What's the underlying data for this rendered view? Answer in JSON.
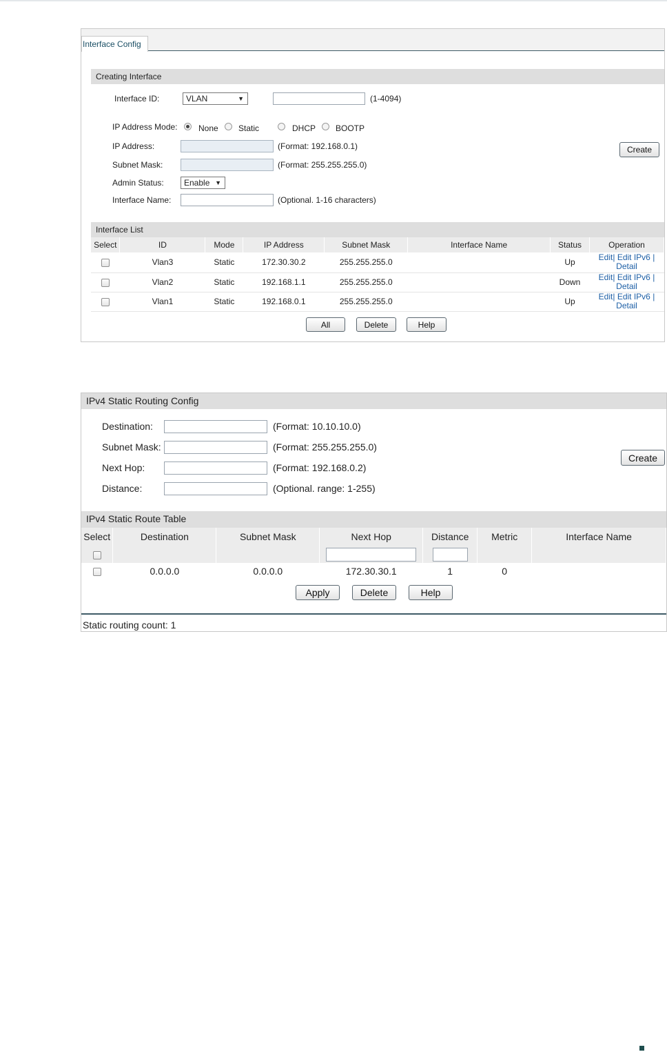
{
  "interface_config": {
    "tab_label": "Interface Config",
    "creating_section_title": "Creating Interface",
    "interface_id_label": "Interface ID:",
    "interface_id_select_value": "VLAN",
    "interface_id_hint": "(1-4094)",
    "ip_mode_label": "IP Address Mode:",
    "ip_modes": [
      "None",
      "Static",
      "DHCP",
      "BOOTP"
    ],
    "ip_mode_selected": "None",
    "ip_address_label": "IP Address:",
    "ip_address_hint": "(Format: 192.168.0.1)",
    "subnet_mask_label": "Subnet Mask:",
    "subnet_mask_hint": "(Format: 255.255.255.0)",
    "admin_status_label": "Admin Status:",
    "admin_status_value": "Enable",
    "interface_name_label": "Interface Name:",
    "interface_name_hint": "(Optional. 1-16 characters)",
    "create_button": "Create",
    "list_section_title": "Interface List",
    "columns": [
      "Select",
      "ID",
      "Mode",
      "IP Address",
      "Subnet Mask",
      "Interface Name",
      "Status",
      "Operation"
    ],
    "rows": [
      {
        "id": "Vlan3",
        "mode": "Static",
        "ip": "172.30.30.2",
        "mask": "255.255.255.0",
        "name": "",
        "status": "Up"
      },
      {
        "id": "Vlan2",
        "mode": "Static",
        "ip": "192.168.1.1",
        "mask": "255.255.255.0",
        "name": "",
        "status": "Down"
      },
      {
        "id": "Vlan1",
        "mode": "Static",
        "ip": "192.168.0.1",
        "mask": "255.255.255.0",
        "name": "",
        "status": "Up"
      }
    ],
    "operation_links": {
      "edit": "Edit",
      "edit_ipv6": "Edit IPv6",
      "detail": "Detail",
      "separator": "|"
    },
    "buttons": {
      "all": "All",
      "delete": "Delete",
      "help": "Help"
    }
  },
  "static_routing": {
    "section_title": "IPv4 Static Routing Config",
    "destination_label": "Destination:",
    "destination_hint": "(Format: 10.10.10.0)",
    "subnet_mask_label": "Subnet Mask:",
    "subnet_mask_hint": "(Format: 255.255.255.0)",
    "next_hop_label": "Next Hop:",
    "next_hop_hint": "(Format: 192.168.0.2)",
    "distance_label": "Distance:",
    "distance_hint": "(Optional. range: 1-255)",
    "create_button": "Create",
    "table_title": "IPv4 Static Route Table",
    "columns": [
      "Select",
      "Destination",
      "Subnet Mask",
      "Next Hop",
      "Distance",
      "Metric",
      "Interface Name"
    ],
    "rows": [
      {
        "destination": "0.0.0.0",
        "mask": "0.0.0.0",
        "next_hop": "172.30.30.1",
        "distance": "1",
        "metric": "0",
        "interface_name": ""
      }
    ],
    "buttons": {
      "apply": "Apply",
      "delete": "Delete",
      "help": "Help"
    },
    "footer_text": "Static routing count: 1"
  }
}
